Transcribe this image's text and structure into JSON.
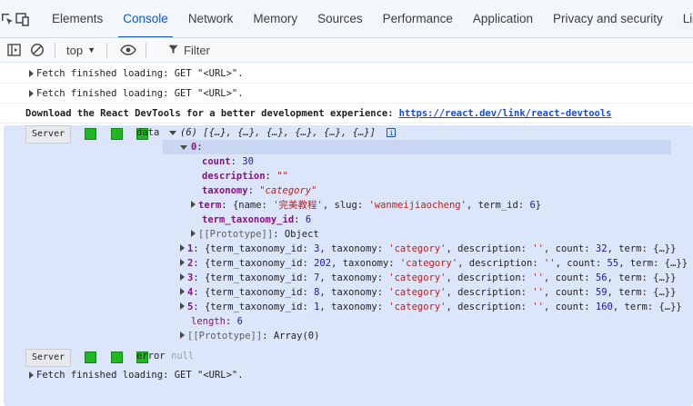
{
  "tabbar": {
    "tabs": [
      "Elements",
      "Console",
      "Network",
      "Memory",
      "Sources",
      "Performance",
      "Application",
      "Privacy and security",
      "Ligh"
    ],
    "active": "Console"
  },
  "toolbar": {
    "context": "top",
    "filter_placeholder": "Filter"
  },
  "console": {
    "fetch_1": "Fetch finished loading: GET \"<URL>\".",
    "fetch_2": "Fetch finished loading: GET \"<URL>\".",
    "devtools_msg": "Download the React DevTools for a better development experience:",
    "devtools_link": "https://react.dev/link/react-devtools",
    "server_badge": "Server",
    "data_label": "data",
    "array_summary": "(6) [{…}, {…}, {…}, {…}, {…}, {…}]",
    "info_icon": "i",
    "item0": {
      "index": "0",
      "count_key": "count",
      "count_val": "30",
      "description_key": "description",
      "description_val": "\"\"",
      "taxonomy_key": "taxonomy",
      "taxonomy_val": "\"category\"",
      "term_key": "term",
      "term_preview_1": "{name: ",
      "term_name": "'完美教程'",
      "term_preview_2": ", slug: ",
      "term_slug": "'wanmeijiaocheng'",
      "term_preview_3": ", term_id: ",
      "term_id": "6",
      "term_preview_4": "}",
      "tti_key": "term_taxonomy_id",
      "tti_val": "6",
      "proto_key": "[[Prototype]]",
      "proto_val": "Object"
    },
    "rows": [
      {
        "idx": "1",
        "tti": "3",
        "count": "32",
        "tail": "term: {…}}"
      },
      {
        "idx": "2",
        "tti": "202",
        "count": "55",
        "tail": "term: {…}}"
      },
      {
        "idx": "3",
        "tti": "7",
        "count": "56",
        "tail": "term: {…}}"
      },
      {
        "idx": "4",
        "tti": "8",
        "count": "59",
        "tail": "term: {…}}"
      },
      {
        "idx": "5",
        "tti": "1",
        "count": "160",
        "tail": "term: {…}}"
      }
    ],
    "row_parts": {
      "open": "{term_taxonomy_id: ",
      "tax": ", taxonomy: ",
      "tax_val": "'category'",
      "desc": ", description: ",
      "desc_val": "''",
      "cnt": ", count: "
    },
    "length_key": "length",
    "length_val": "6",
    "array_proto_key": "[[Prototype]]",
    "array_proto_val": "Array(0)",
    "server_badge_2": "Server",
    "error_label": "error",
    "error_val": "null",
    "fetch_3": "Fetch finished loading: GET \"<URL>\"."
  }
}
